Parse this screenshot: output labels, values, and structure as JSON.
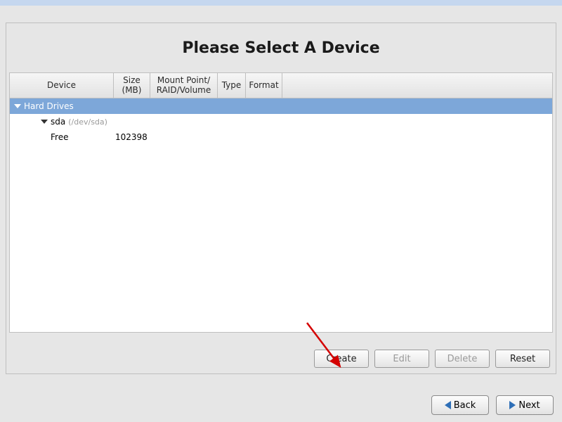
{
  "title": "Please Select A Device",
  "columns": {
    "device": "Device",
    "size": "Size\n(MB)",
    "mount": "Mount Point/\nRAID/Volume",
    "type": "Type",
    "format": "Format"
  },
  "tree": {
    "group_label": "Hard Drives",
    "disk": {
      "name": "sda",
      "path": "(/dev/sda)"
    },
    "partitions": [
      {
        "label": "Free",
        "size": "102398"
      }
    ]
  },
  "buttons": {
    "create": "Create",
    "edit": "Edit",
    "delete": "Delete",
    "reset": "Reset"
  },
  "nav": {
    "back": "Back",
    "next": "Next"
  }
}
